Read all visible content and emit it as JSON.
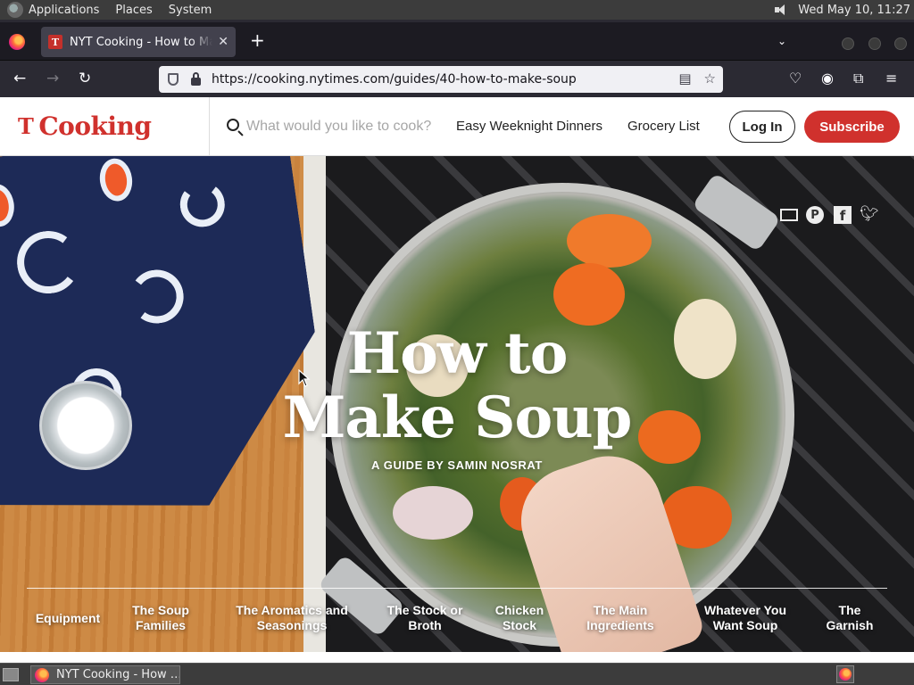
{
  "top_panel": {
    "menus": [
      "Applications",
      "Places",
      "System"
    ],
    "datetime": "Wed May 10, 11:27"
  },
  "browser": {
    "tab_title": "NYT Cooking - How to Make Soup",
    "tab_favicon_letter": "T",
    "url_prefix": "https://cooking.",
    "url_host": "nytimes.com",
    "url_path": "/guides/40-how-to-make-soup"
  },
  "site": {
    "brand_icon": "T",
    "brand_name": "Cooking",
    "search_placeholder": "What would you like to cook?",
    "nav_links": [
      "Easy Weeknight Dinners",
      "Grocery List"
    ],
    "login_label": "Log In",
    "subscribe_label": "Subscribe",
    "brand_color": "#d0312d"
  },
  "hero": {
    "title_line1": "How to",
    "title_line2": "Make Soup",
    "subtitle": "A GUIDE BY SAMIN NOSRAT",
    "share_icons": [
      "mail-icon",
      "pinterest-icon",
      "facebook-icon",
      "twitter-icon"
    ],
    "chapters": [
      {
        "line1": "Equipment",
        "line2": ""
      },
      {
        "line1": "The Soup",
        "line2": "Families"
      },
      {
        "line1": "The Aromatics and",
        "line2": "Seasonings"
      },
      {
        "line1": "The Stock or",
        "line2": "Broth"
      },
      {
        "line1": "Chicken",
        "line2": "Stock"
      },
      {
        "line1": "The Main",
        "line2": "Ingredients"
      },
      {
        "line1": "Whatever You",
        "line2": "Want Soup"
      },
      {
        "line1": "The",
        "line2": "Garnish"
      }
    ]
  },
  "taskbar": {
    "task_label": "NYT Cooking - How …"
  }
}
